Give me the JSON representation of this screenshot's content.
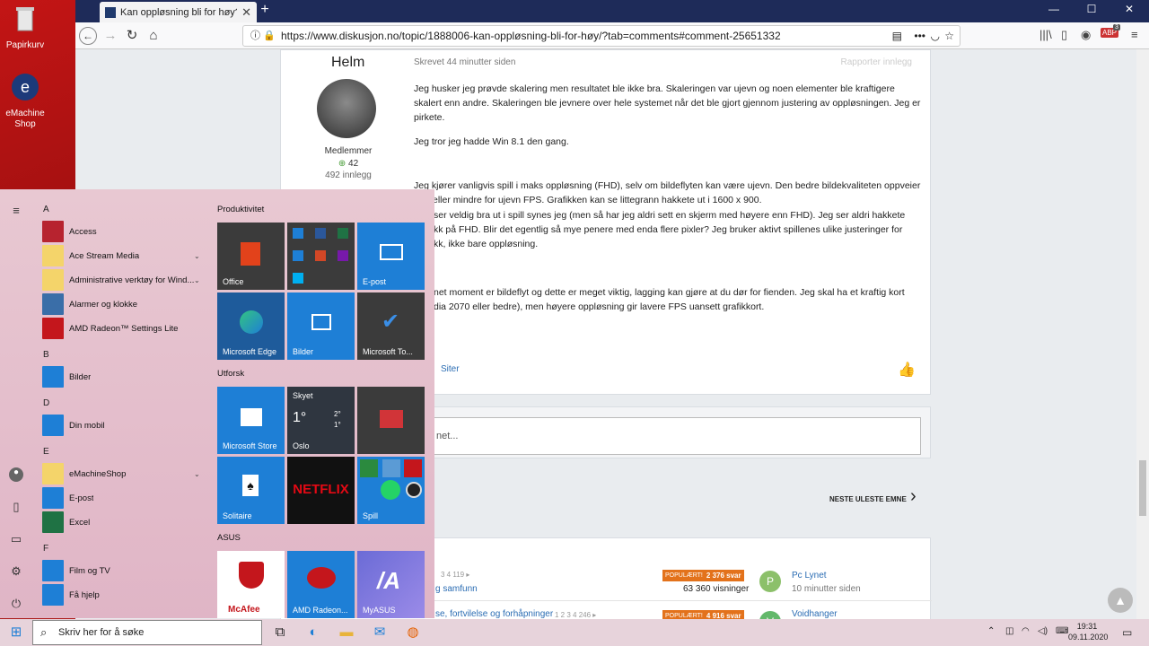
{
  "desktop": {
    "icons": [
      {
        "label": "Papirkurv"
      },
      {
        "label": "eMachine Shop"
      }
    ]
  },
  "browser": {
    "tab_title": "Kan oppløsning bli for høy? - S",
    "url": "https://www.diskusjon.no/topic/1888006-kan-oppløsning-bli-for-høy/?tab=comments#comment-25651332",
    "abp_badge": "3"
  },
  "post": {
    "author": "Helm",
    "timestamp": "Skrevet 44 minutter siden",
    "report": "Rapporter innlegg",
    "role": "Medlemmer",
    "rep": "42",
    "posts": "492 innlegg",
    "p1": "Jeg husker jeg prøvde skalering men resultatet ble ikke bra. Skaleringen var ujevn og noen elementer ble kraftigere skalert enn andre. Skaleringen ble jevnere over hele systemet når det ble gjort gjennom justering av oppløsningen. Jeg er pirkete.",
    "p2": "Jeg tror jeg hadde Win 8.1 den gang.",
    "p3": "Jeg kjører vanligvis spill i maks oppløsning (FHD), selv om bildeflyten kan være ujevn. Den bedre bildekvaliteten oppveier mer eller mindre for ujevn FPS. Grafikken kan se littegrann hakkete ut i 1600 x 900.",
    "p4a": "ser veldig bra ut i spill synes jeg (men så har jeg aldri sett en skjerm med høyere enn FHD). Jeg ser aldri hakkete",
    "p4b": "kk på FHD. Blir det egentlig så mye penere med enda flere pixler? Jeg bruker aktivt spillenes ulike justeringer for",
    "p4c": "kk, ikke bare oppløsning.",
    "p5a": "net moment er bildeflyt og dette er meget viktig, lagging kan gjøre at du dør for fienden. Jeg skal ha et kraftig kort",
    "p5b": "dia 2070 eller bedre), men høyere oppløsning gir lavere FPS uansett grafikkort.",
    "quote": "Siter"
  },
  "reply": {
    "placeholder": "net..."
  },
  "next": {
    "label": "NESTE ULESTE EMNE"
  },
  "topics": [
    {
      "pages": "3   4   119 ▸",
      "title": "g samfunn",
      "badge": "POPULÆRT!",
      "replies": "2 376 svar",
      "views": "63 360 visninger",
      "avatar": "P",
      "user": "Pc Lynet",
      "time": "10 minutter siden",
      "avcolor": "#8cc06a"
    },
    {
      "pages": "1   2   3   4   246 ▸",
      "title": "se, fortvilelse og forhåpninger",
      "badge": "POPULÆRT!",
      "replies": "4 916 svar",
      "views": "",
      "avatar": "V",
      "user": "Voidhanger",
      "time": "",
      "avcolor": "#63b86b"
    }
  ],
  "start": {
    "letters": [
      "A",
      "B",
      "D",
      "E",
      "F"
    ],
    "apps": [
      {
        "label": "Access",
        "color": "#b7232f"
      },
      {
        "label": "Ace Stream Media",
        "color": "#f4d46a"
      },
      {
        "label": "Administrative verktøy for Wind...",
        "color": "#f4d46a"
      },
      {
        "label": "Alarmer og klokke",
        "color": "#3a6ea8"
      },
      {
        "label": "AMD Radeon™ Settings Lite",
        "color": "#c4161c"
      },
      {
        "label": "Bilder",
        "color": "#1e7fd6"
      },
      {
        "label": "Din mobil",
        "color": "#1e7fd6"
      },
      {
        "label": "eMachineShop",
        "color": "#f4d46a"
      },
      {
        "label": "E-post",
        "color": "#1e7fd6"
      },
      {
        "label": "Excel",
        "color": "#1f7244"
      },
      {
        "label": "Film og TV",
        "color": "#1e7fd6"
      },
      {
        "label": "Få hjelp",
        "color": "#1e7fd6"
      }
    ],
    "groups": [
      "Produktivitet",
      "Utforsk",
      "ASUS"
    ],
    "tiles": [
      {
        "label": "Office",
        "bg": "#3b3b3b"
      },
      {
        "label": "",
        "bg": "#3b3b3b"
      },
      {
        "label": "E-post",
        "bg": "#1e7fd6"
      },
      {
        "label": "Microsoft Edge",
        "bg": "#1e5b9b"
      },
      {
        "label": "Bilder",
        "bg": "#1e7fd6"
      },
      {
        "label": "Microsoft To...",
        "bg": "#3b3b3b"
      },
      {
        "label": "Microsoft Store",
        "bg": "#1e7fd6"
      },
      {
        "label": "Oslo",
        "bg": "#2f3640"
      },
      {
        "label": "",
        "bg": "#3b3b3b"
      },
      {
        "label": "Solitaire",
        "bg": "#1e7fd6"
      },
      {
        "label": "",
        "bg": "#111111"
      },
      {
        "label": "Spill",
        "bg": "#1e7fd6"
      },
      {
        "label": "McAfee",
        "bg": "#ffffff"
      },
      {
        "label": "AMD Radeon...",
        "bg": "#1e7fd6"
      },
      {
        "label": "MyASUS",
        "bg": "#7b7bd8"
      }
    ],
    "weather": {
      "title": "Skyet",
      "temp": "1°",
      "hi": "2°",
      "lo": "1°"
    },
    "netflix": "NETFLIX"
  },
  "taskbar": {
    "search_placeholder": "Skriv her for å søke",
    "time": "19:31",
    "date": "09.11.2020"
  }
}
